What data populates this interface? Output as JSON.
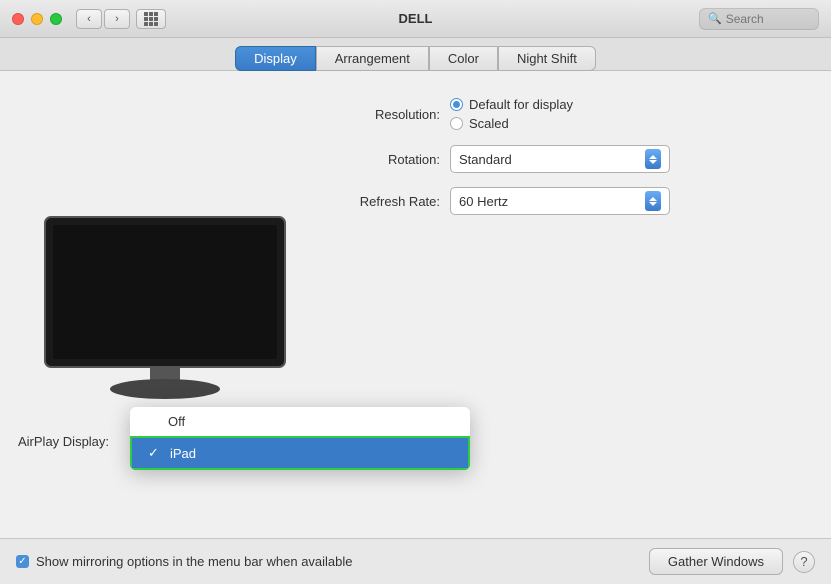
{
  "titlebar": {
    "title": "DELL",
    "search_placeholder": "Search"
  },
  "tabs": [
    {
      "label": "Display",
      "active": true
    },
    {
      "label": "Arrangement",
      "active": false
    },
    {
      "label": "Color",
      "active": false
    },
    {
      "label": "Night Shift",
      "active": false
    }
  ],
  "settings": {
    "resolution_label": "Resolution:",
    "resolution_default": "Default for display",
    "resolution_scaled": "Scaled",
    "rotation_label": "Rotation:",
    "rotation_value": "Standard",
    "refresh_label": "Refresh Rate:",
    "refresh_value": "60 Hertz"
  },
  "airplay": {
    "label": "AirPlay Display:",
    "dropdown": {
      "options": [
        {
          "label": "Off",
          "selected": false
        },
        {
          "label": "iPad",
          "selected": true
        }
      ]
    }
  },
  "bottombar": {
    "checkbox_label": "Show mirroring options in the menu bar when available",
    "gather_btn": "Gather Windows",
    "help_btn": "?"
  }
}
